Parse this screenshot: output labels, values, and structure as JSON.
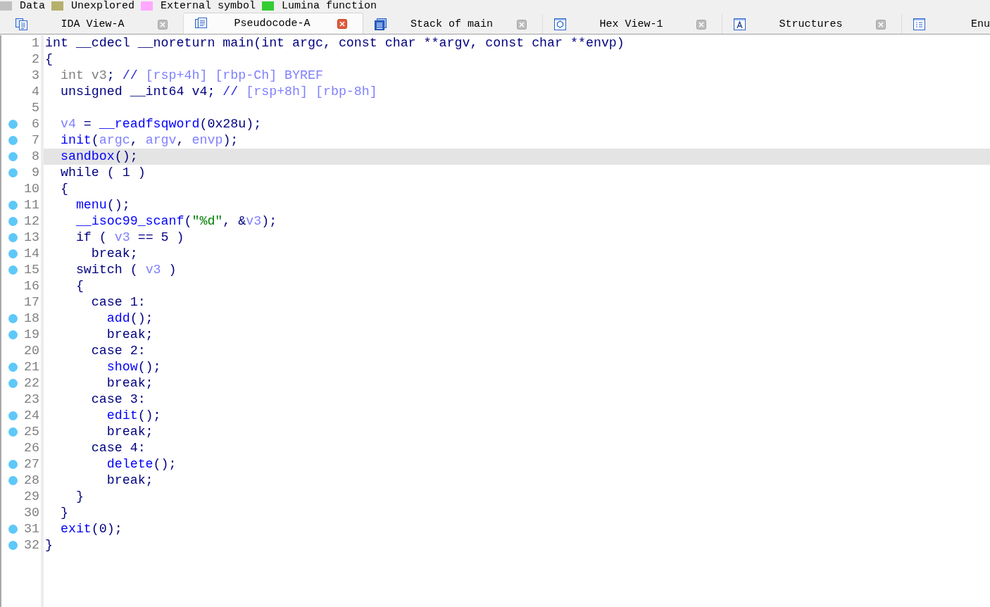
{
  "legend": {
    "items": [
      {
        "label": "Data",
        "color": "#c0c0c0"
      },
      {
        "label": "Unexplored",
        "color": "#b5b06c"
      },
      {
        "label": "External symbol",
        "color": "#ffa8ff"
      },
      {
        "label": "Lumina function",
        "color": "#33cc33"
      }
    ]
  },
  "tabs": [
    {
      "kind": "listing",
      "label": "IDA View-A",
      "selected": false
    },
    {
      "kind": "document",
      "label": "Pseudocode-A",
      "selected": true
    },
    {
      "kind": "stack",
      "label": "Stack of main",
      "selected": false
    },
    {
      "kind": "hexagon",
      "label": "Hex View-1",
      "selected": false
    },
    {
      "kind": "letter",
      "label": "Structures",
      "selected": false
    },
    {
      "kind": "list",
      "label": "Enu",
      "selected": false
    }
  ],
  "code": {
    "lines": [
      {
        "number": "1",
        "breakpoint": false,
        "highlighted": false,
        "tokens": [
          {
            "kind": "plain",
            "text": "int __cdecl __noreturn main(int argc, const char **argv, const char **envp)"
          }
        ]
      },
      {
        "number": "2",
        "breakpoint": false,
        "highlighted": false,
        "tokens": [
          {
            "kind": "plain",
            "text": "{"
          }
        ]
      },
      {
        "number": "3",
        "breakpoint": false,
        "highlighted": false,
        "tokens": [
          {
            "kind": "dim",
            "text": "  int v3"
          },
          {
            "kind": "plain",
            "text": ";"
          },
          {
            "kind": "comment",
            "text": " //"
          },
          {
            "kind": "note",
            "text": " [rsp+4h] [rbp-Ch] BYREF"
          }
        ]
      },
      {
        "number": "4",
        "breakpoint": false,
        "highlighted": false,
        "tokens": [
          {
            "kind": "plain",
            "text": "  unsigned __int64 v4;"
          },
          {
            "kind": "comment",
            "text": " //"
          },
          {
            "kind": "note",
            "text": " [rsp+8h] [rbp-8h]"
          }
        ]
      },
      {
        "number": "5",
        "breakpoint": false,
        "highlighted": false
      },
      {
        "number": "6",
        "breakpoint": true,
        "highlighted": false,
        "tokens": [
          {
            "kind": "var",
            "text": "  v4"
          },
          {
            "kind": "plain",
            "text": " = "
          },
          {
            "kind": "func",
            "text": "__readfsqword"
          },
          {
            "kind": "plain",
            "text": "(0x28u);"
          }
        ]
      },
      {
        "number": "7",
        "breakpoint": true,
        "highlighted": false,
        "tokens": [
          {
            "kind": "func",
            "text": "  init"
          },
          {
            "kind": "plain",
            "text": "("
          },
          {
            "kind": "var",
            "text": "argc"
          },
          {
            "kind": "plain",
            "text": ", "
          },
          {
            "kind": "var",
            "text": "argv"
          },
          {
            "kind": "plain",
            "text": ", "
          },
          {
            "kind": "var",
            "text": "envp"
          },
          {
            "kind": "plain",
            "text": ");"
          }
        ]
      },
      {
        "number": "8",
        "breakpoint": true,
        "highlighted": true,
        "tokens": [
          {
            "kind": "func",
            "text": "  sandbox"
          },
          {
            "kind": "plain",
            "text": "();"
          }
        ]
      },
      {
        "number": "9",
        "breakpoint": true,
        "highlighted": false,
        "tokens": [
          {
            "kind": "plain",
            "text": "  while ( 1 )"
          }
        ]
      },
      {
        "number": "10",
        "breakpoint": false,
        "highlighted": false,
        "tokens": [
          {
            "kind": "plain",
            "text": "  {"
          }
        ]
      },
      {
        "number": "11",
        "breakpoint": true,
        "highlighted": false,
        "tokens": [
          {
            "kind": "func",
            "text": "    menu"
          },
          {
            "kind": "plain",
            "text": "();"
          }
        ]
      },
      {
        "number": "12",
        "breakpoint": true,
        "highlighted": false,
        "tokens": [
          {
            "kind": "func",
            "text": "    __isoc99_scanf"
          },
          {
            "kind": "plain",
            "text": "("
          },
          {
            "kind": "string",
            "text": "\"%d\""
          },
          {
            "kind": "plain",
            "text": ", &"
          },
          {
            "kind": "var",
            "text": "v3"
          },
          {
            "kind": "plain",
            "text": ");"
          }
        ]
      },
      {
        "number": "13",
        "breakpoint": true,
        "highlighted": false,
        "tokens": [
          {
            "kind": "plain",
            "text": "    if ( "
          },
          {
            "kind": "var",
            "text": "v3"
          },
          {
            "kind": "plain",
            "text": " == 5 )"
          }
        ]
      },
      {
        "number": "14",
        "breakpoint": true,
        "highlighted": false,
        "tokens": [
          {
            "kind": "plain",
            "text": "      break;"
          }
        ]
      },
      {
        "number": "15",
        "breakpoint": true,
        "highlighted": false,
        "tokens": [
          {
            "kind": "plain",
            "text": "    switch ( "
          },
          {
            "kind": "var",
            "text": "v3"
          },
          {
            "kind": "plain",
            "text": " )"
          }
        ]
      },
      {
        "number": "16",
        "breakpoint": false,
        "highlighted": false,
        "tokens": [
          {
            "kind": "plain",
            "text": "    {"
          }
        ]
      },
      {
        "number": "17",
        "breakpoint": false,
        "highlighted": false,
        "tokens": [
          {
            "kind": "plain",
            "text": "      case 1:"
          }
        ]
      },
      {
        "number": "18",
        "breakpoint": true,
        "highlighted": false,
        "tokens": [
          {
            "kind": "func",
            "text": "        add"
          },
          {
            "kind": "plain",
            "text": "();"
          }
        ]
      },
      {
        "number": "19",
        "breakpoint": true,
        "highlighted": false,
        "tokens": [
          {
            "kind": "plain",
            "text": "        break;"
          }
        ]
      },
      {
        "number": "20",
        "breakpoint": false,
        "highlighted": false,
        "tokens": [
          {
            "kind": "plain",
            "text": "      case 2:"
          }
        ]
      },
      {
        "number": "21",
        "breakpoint": true,
        "highlighted": false,
        "tokens": [
          {
            "kind": "func",
            "text": "        show"
          },
          {
            "kind": "plain",
            "text": "();"
          }
        ]
      },
      {
        "number": "22",
        "breakpoint": true,
        "highlighted": false,
        "tokens": [
          {
            "kind": "plain",
            "text": "        break;"
          }
        ]
      },
      {
        "number": "23",
        "breakpoint": false,
        "highlighted": false,
        "tokens": [
          {
            "kind": "plain",
            "text": "      case 3:"
          }
        ]
      },
      {
        "number": "24",
        "breakpoint": true,
        "highlighted": false,
        "tokens": [
          {
            "kind": "func",
            "text": "        edit"
          },
          {
            "kind": "plain",
            "text": "();"
          }
        ]
      },
      {
        "number": "25",
        "breakpoint": true,
        "highlighted": false,
        "tokens": [
          {
            "kind": "plain",
            "text": "        break;"
          }
        ]
      },
      {
        "number": "26",
        "breakpoint": false,
        "highlighted": false,
        "tokens": [
          {
            "kind": "plain",
            "text": "      case 4:"
          }
        ]
      },
      {
        "number": "27",
        "breakpoint": true,
        "highlighted": false,
        "tokens": [
          {
            "kind": "func",
            "text": "        delete"
          },
          {
            "kind": "plain",
            "text": "();"
          }
        ]
      },
      {
        "number": "28",
        "breakpoint": true,
        "highlighted": false,
        "tokens": [
          {
            "kind": "plain",
            "text": "        break;"
          }
        ]
      },
      {
        "number": "29",
        "breakpoint": false,
        "highlighted": false,
        "tokens": [
          {
            "kind": "plain",
            "text": "    }"
          }
        ]
      },
      {
        "number": "30",
        "breakpoint": false,
        "highlighted": false,
        "tokens": [
          {
            "kind": "plain",
            "text": "  }"
          }
        ]
      },
      {
        "number": "31",
        "breakpoint": true,
        "highlighted": false,
        "tokens": [
          {
            "kind": "func",
            "text": "  exit"
          },
          {
            "kind": "plain",
            "text": "(0);"
          }
        ]
      },
      {
        "number": "32",
        "breakpoint": true,
        "highlighted": false,
        "tokens": [
          {
            "kind": "plain",
            "text": "}"
          }
        ]
      }
    ]
  }
}
